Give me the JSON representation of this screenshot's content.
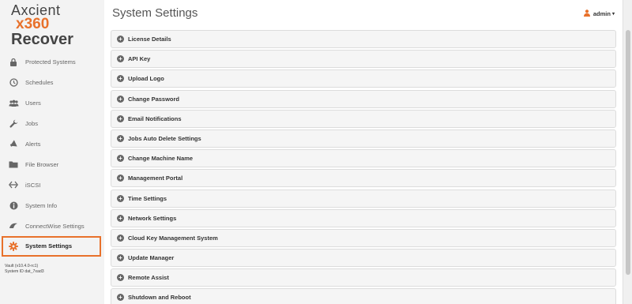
{
  "logo": {
    "line1": "Axcient",
    "line2": "x360",
    "line3": "Recover"
  },
  "header": {
    "title": "System Settings",
    "user": "admin"
  },
  "nav": [
    {
      "label": "Protected Systems",
      "icon": "lock-icon"
    },
    {
      "label": "Schedules",
      "icon": "clock-icon"
    },
    {
      "label": "Users",
      "icon": "users-icon"
    },
    {
      "label": "Jobs",
      "icon": "wrench-icon"
    },
    {
      "label": "Alerts",
      "icon": "megaphone-icon"
    },
    {
      "label": "File Browser",
      "icon": "folder-icon"
    },
    {
      "label": "iSCSI",
      "icon": "exchange-icon"
    },
    {
      "label": "System Info",
      "icon": "info-icon"
    },
    {
      "label": "ConnectWise Settings",
      "icon": "connectwise-icon"
    },
    {
      "label": "System Settings",
      "icon": "gear-icon",
      "active": true
    }
  ],
  "footer": {
    "vault": "Vault (v10.4.0-rc1)",
    "system_id": "System ID dat_7xad3"
  },
  "panels": [
    "License Details",
    "API Key",
    "Upload Logo",
    "Change Password",
    "Email Notifications",
    "Jobs Auto Delete Settings",
    "Change Machine Name",
    "Management Portal",
    "Time Settings",
    "Network Settings",
    "Cloud Key Management System",
    "Update Manager",
    "Remote Assist",
    "Shutdown and Reboot"
  ],
  "colors": {
    "accent": "#e8712b",
    "sidebar_bg": "#f3f3f3",
    "panel_bg": "#f5f5f5"
  }
}
